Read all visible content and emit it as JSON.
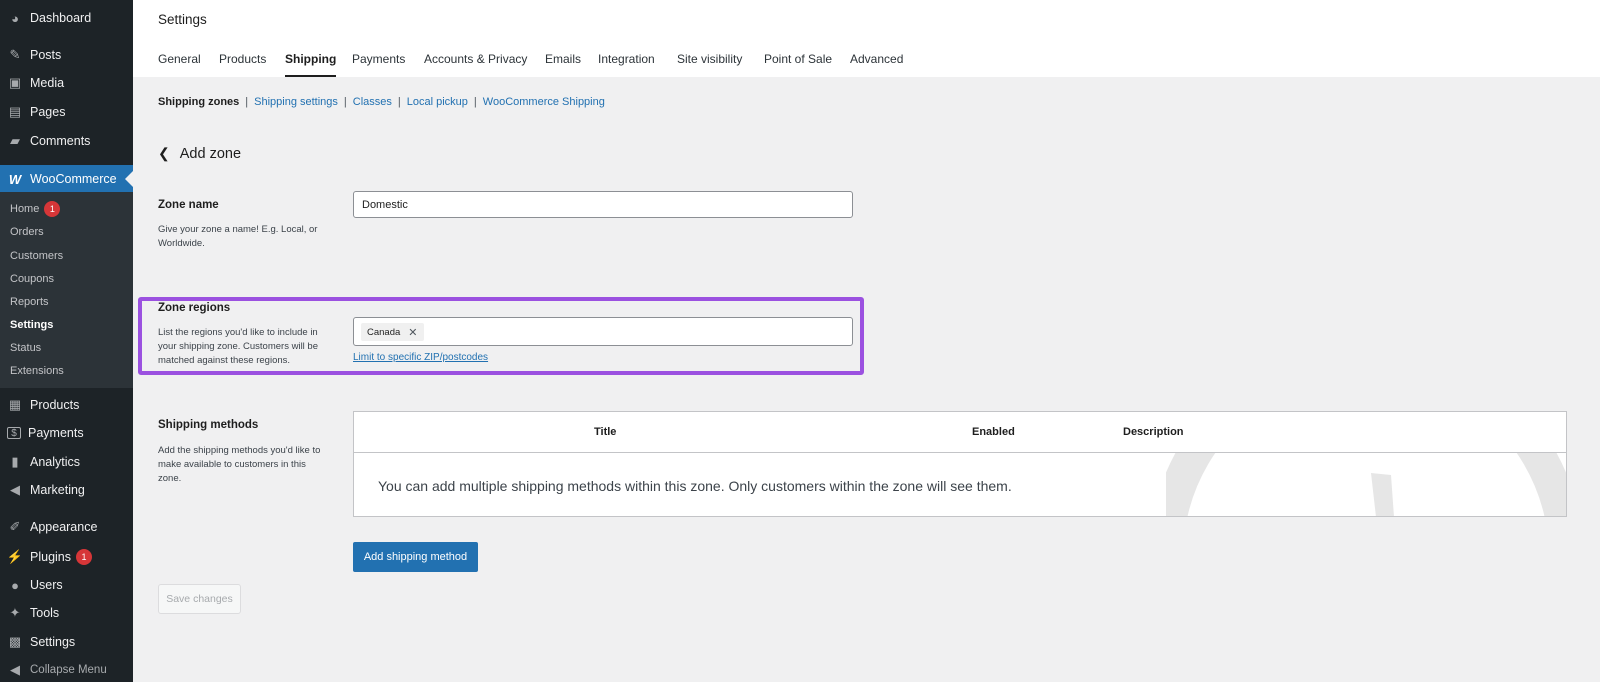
{
  "sidebar": {
    "items": [
      {
        "label": "Dashboard",
        "icon": "dashboard-icon",
        "glyph": "◕"
      },
      {
        "label": "Posts",
        "icon": "pin-icon",
        "glyph": "✎"
      },
      {
        "label": "Media",
        "icon": "media-icon",
        "glyph": "▣"
      },
      {
        "label": "Pages",
        "icon": "pages-icon",
        "glyph": "▤"
      },
      {
        "label": "Comments",
        "icon": "comments-icon",
        "glyph": "▰"
      },
      {
        "label": "WooCommerce",
        "icon": "woo-icon",
        "glyph": "W"
      },
      {
        "label": "Products",
        "icon": "products-icon",
        "glyph": "▦"
      },
      {
        "label": "Payments",
        "icon": "payments-icon",
        "glyph": "$"
      },
      {
        "label": "Analytics",
        "icon": "analytics-icon",
        "glyph": "▮"
      },
      {
        "label": "Marketing",
        "icon": "megaphone-icon",
        "glyph": "◀"
      },
      {
        "label": "Appearance",
        "icon": "paintbrush-icon",
        "glyph": "✐"
      },
      {
        "label": "Plugins",
        "icon": "plugins-icon",
        "glyph": "⚡",
        "badge": "1"
      },
      {
        "label": "Users",
        "icon": "users-icon",
        "glyph": "●"
      },
      {
        "label": "Tools",
        "icon": "wrench-icon",
        "glyph": "✦"
      },
      {
        "label": "Settings",
        "icon": "settings-icon",
        "glyph": "▩"
      }
    ],
    "submenu": [
      {
        "label": "Home",
        "badge": "1"
      },
      {
        "label": "Orders"
      },
      {
        "label": "Customers"
      },
      {
        "label": "Coupons"
      },
      {
        "label": "Reports"
      },
      {
        "label": "Settings"
      },
      {
        "label": "Status"
      },
      {
        "label": "Extensions"
      }
    ],
    "collapse_label": "Collapse Menu"
  },
  "header": {
    "title": "Settings",
    "tabs": [
      "General",
      "Products",
      "Shipping",
      "Payments",
      "Accounts & Privacy",
      "Emails",
      "Integration",
      "Site visibility",
      "Point of Sale",
      "Advanced"
    ],
    "active_tab": "Shipping"
  },
  "subnav": {
    "current": "Shipping zones",
    "links": [
      "Shipping settings",
      "Classes",
      "Local pickup",
      "WooCommerce Shipping"
    ],
    "separator": "|"
  },
  "page": {
    "back_label": "Add zone"
  },
  "zone_name": {
    "title": "Zone name",
    "description": "Give your zone a name! E.g. Local, or Worldwide.",
    "value": "Domestic"
  },
  "zone_regions": {
    "title": "Zone regions",
    "description": "List the regions you'd like to include in your shipping zone. Customers will be matched against these regions.",
    "selected": "Canada",
    "remove_glyph": "✕",
    "zip_link": "Limit to specific ZIP/postcodes"
  },
  "shipping_methods": {
    "title": "Shipping methods",
    "description": "Add the shipping methods you'd like to make available to customers in this zone.",
    "columns": [
      "Title",
      "Enabled",
      "Description"
    ],
    "empty_message": "You can add multiple shipping methods within this zone. Only customers within the zone will see them.",
    "add_button": "Add shipping method"
  },
  "save_button": "Save changes",
  "colors": {
    "sidebar_bg": "#1d2327",
    "accent": "#2271b1",
    "highlight": "#9b51e0",
    "badge": "#d63638"
  }
}
